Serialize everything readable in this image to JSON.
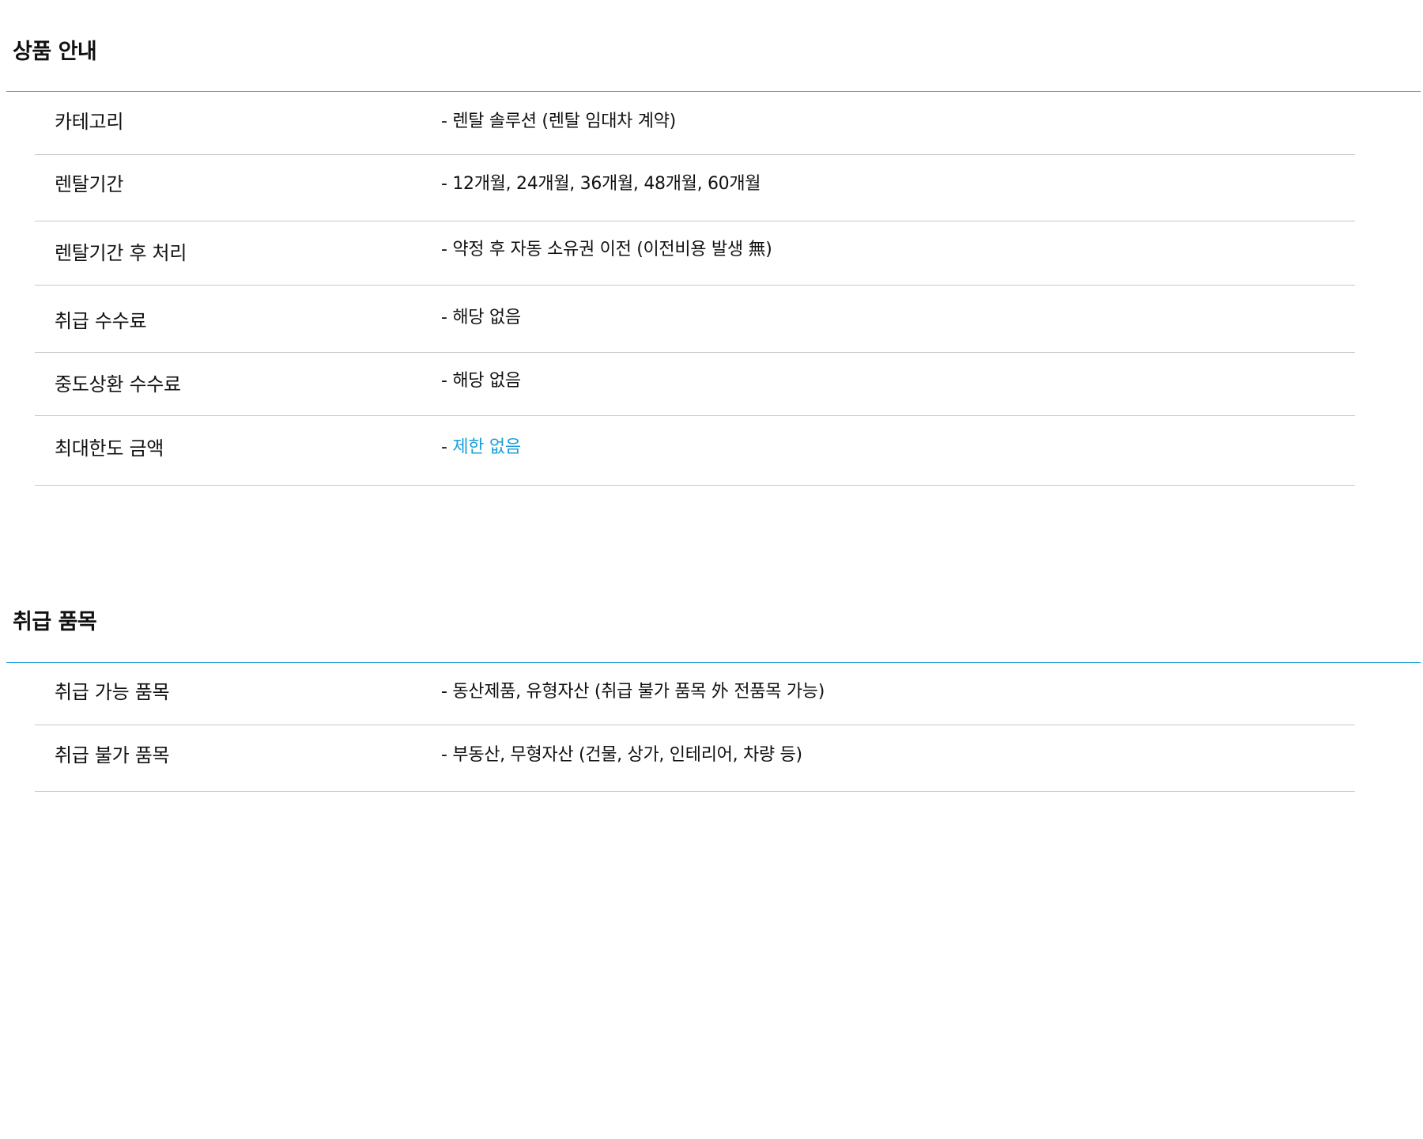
{
  "product_info": {
    "title": "상품 안내",
    "rows": [
      {
        "label": "카테고리",
        "value": "- 렌탈 솔루션 (렌탈 임대차 계약)"
      },
      {
        "label": "렌탈기간",
        "value": "- 12개월, 24개월, 36개월, 48개월, 60개월"
      },
      {
        "label": "렌탈기간 후 처리",
        "value": "- 약정 후 자동 소유권 이전 (이전비용 발생 無)"
      },
      {
        "label": "취급 수수료",
        "value": "- 해당 없음"
      },
      {
        "label": "중도상환 수수료",
        "value": "- 해당 없음"
      },
      {
        "label": "최대한도 금액",
        "value_prefix": "- ",
        "value_highlight": "제한 없음"
      }
    ]
  },
  "items_info": {
    "title": "취급 품목",
    "rows": [
      {
        "label": "취급 가능 품목",
        "value": "- 동산제품, 유형자산 (취급 불가 품목 外 전품목 가능)"
      },
      {
        "label": "취급 불가 품목",
        "value": "- 부동산, 무형자산 (건물, 상가, 인테리어, 차량 등)"
      }
    ]
  },
  "colors": {
    "accent": "#1aa0dc",
    "divider": "#c8c8c8",
    "text": "#111111"
  }
}
